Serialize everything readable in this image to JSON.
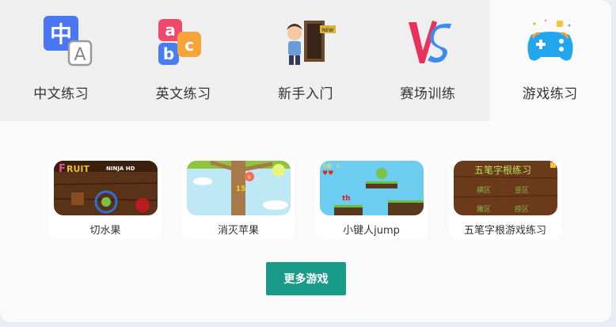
{
  "tabs": [
    {
      "label": "中文练习",
      "icon": "chinese-char-icon",
      "active": false
    },
    {
      "label": "英文练习",
      "icon": "abc-blocks-icon",
      "active": false
    },
    {
      "label": "新手入门",
      "icon": "person-door-icon",
      "active": false
    },
    {
      "label": "赛场训练",
      "icon": "vs-icon",
      "active": false
    },
    {
      "label": "游戏练习",
      "icon": "gamepad-icon",
      "active": true
    }
  ],
  "games": [
    {
      "name": "切水果",
      "thumb_text": "FRUIT NINJA HD"
    },
    {
      "name": "消灭苹果",
      "thumb_text": "15"
    },
    {
      "name": "小键人jump",
      "thumb_text": "th"
    },
    {
      "name": "五笔字根游戏练习",
      "thumb_text": "五笔字根练习"
    }
  ],
  "more_button": "更多游戏",
  "colors": {
    "accent": "#1a9b8a",
    "tab_bg": "#efefef",
    "active_tab": "#fafafa"
  }
}
